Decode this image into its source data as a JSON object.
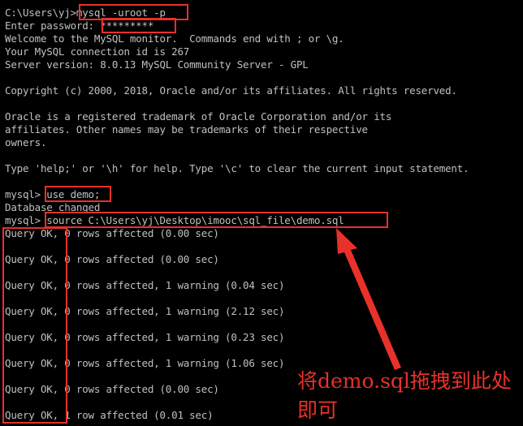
{
  "terminal": {
    "lines": [
      "C:\\Users\\yj>mysql -uroot -p",
      "Enter password: *********",
      "Welcome to the MySQL monitor.  Commands end with ; or \\g.",
      "Your MySQL connection id is 267",
      "Server version: 8.0.13 MySQL Community Server - GPL",
      "",
      "Copyright (c) 2000, 2018, Oracle and/or its affiliates. All rights reserved.",
      "",
      "Oracle is a registered trademark of Oracle Corporation and/or its",
      "affiliates. Other names may be trademarks of their respective",
      "owners.",
      "",
      "Type 'help;' or '\\h' for help. Type '\\c' to clear the current input statement.",
      "",
      "mysql> use demo;",
      "Database changed",
      "mysql> source C:\\Users\\yj\\Desktop\\imooc\\sql_file\\demo.sql",
      "Query OK, 0 rows affected (0.00 sec)",
      "",
      "Query OK, 0 rows affected (0.00 sec)",
      "",
      "Query OK, 0 rows affected, 1 warning (0.04 sec)",
      "",
      "Query OK, 0 rows affected, 1 warning (2.12 sec)",
      "",
      "Query OK, 0 rows affected, 1 warning (0.23 sec)",
      "",
      "Query OK, 0 rows affected, 1 warning (1.06 sec)",
      "",
      "Query OK, 0 rows affected (0.00 sec)",
      "",
      "Query OK, 1 row affected (0.01 sec)"
    ]
  },
  "annotation": {
    "text": "将demo.sql拖拽到此处即可",
    "color": "#e8312a"
  },
  "colors": {
    "background": "#000000",
    "text": "#c0c0c0",
    "highlight": "#e8312a"
  }
}
